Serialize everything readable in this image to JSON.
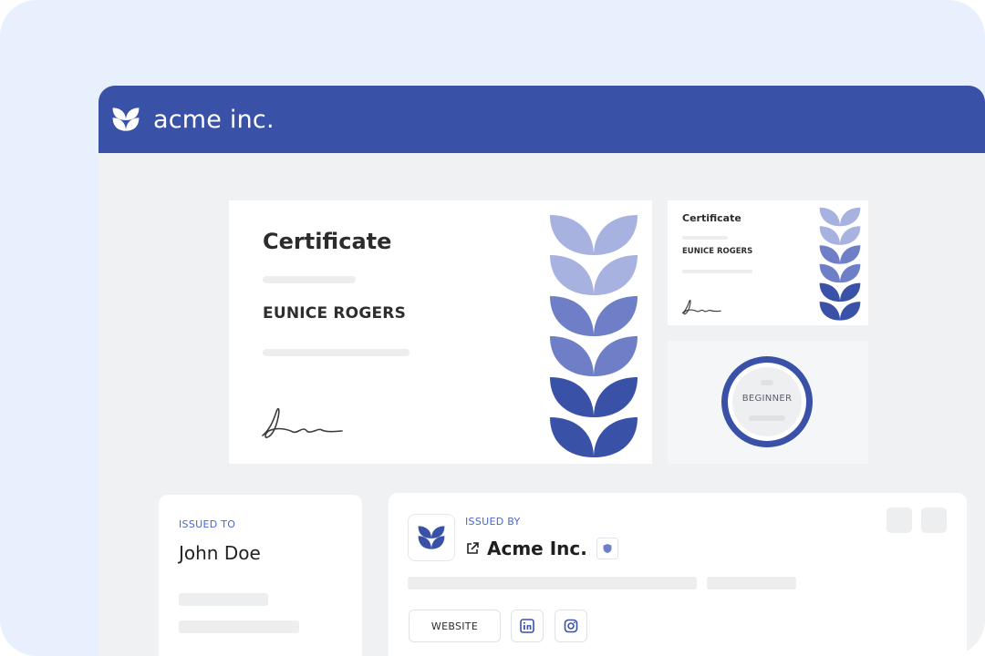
{
  "brand": {
    "name": "acme inc.",
    "logo_icon": "leaf-logo-icon",
    "header_color": "#3a51a8"
  },
  "certificate": {
    "title": "Certificate",
    "recipient_name": "EUNICE ROGERS",
    "signature_icon": "signature-icon"
  },
  "certificate_thumbnail": {
    "title": "Certificate",
    "recipient_name": "EUNICE ROGERS"
  },
  "badge": {
    "label": "BEGINNER",
    "ring_color": "#3a51a8"
  },
  "issued_to": {
    "label": "ISSUED TO",
    "name": "John Doe"
  },
  "issued_by": {
    "label": "ISSUED BY",
    "org_name": "Acme Inc.",
    "external_link_icon": "external-link-icon",
    "verified_icon": "verified-shield-icon",
    "website_label": "WEBSITE",
    "social": [
      "linkedin-icon",
      "instagram-icon"
    ]
  },
  "colors": {
    "accent": "#3a51a8",
    "label_blue": "#4a67c9",
    "leaf_light": "#a8b2e0",
    "leaf_mid": "#6e7fc8",
    "leaf_dark": "#3a51a8"
  }
}
